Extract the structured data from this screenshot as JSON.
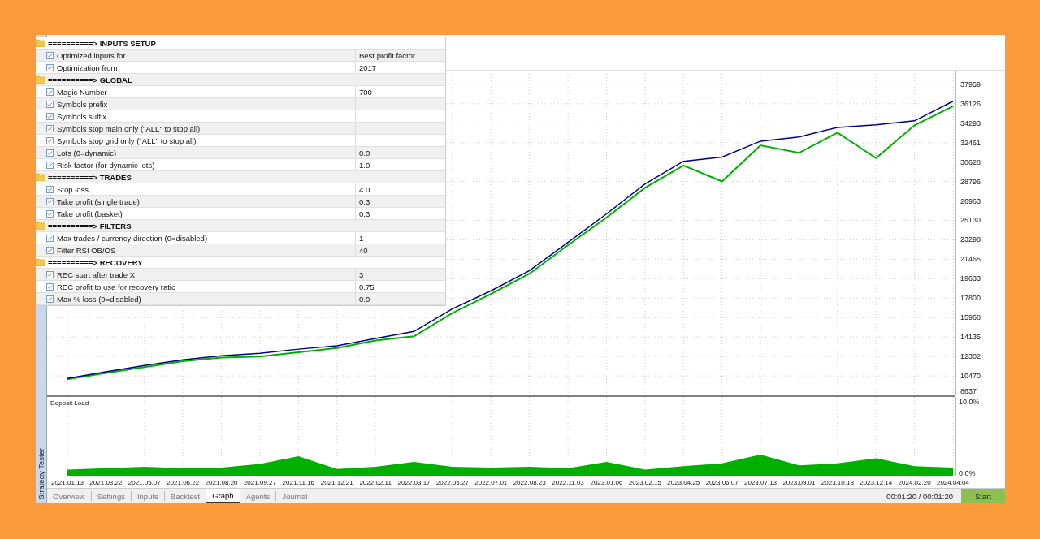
{
  "inputs": {
    "groups": [
      {
        "title": "==========> INPUTS SETUP",
        "items": [
          {
            "label": "Optimized inputs for",
            "value": "Best profit factor",
            "checked": true
          },
          {
            "label": "Optimization from",
            "value": "2017",
            "checked": true
          }
        ]
      },
      {
        "title": "==========> GLOBAL",
        "items": [
          {
            "label": "Magic Number",
            "value": "700",
            "checked": true
          },
          {
            "label": "Symbols prefix",
            "checked": true
          },
          {
            "label": "Symbols suffix",
            "checked": true
          },
          {
            "label": "Symbols stop main only (\"ALL\" to stop all)",
            "checked": true
          },
          {
            "label": "Symbols stop grid only (\"ALL\" to stop all)",
            "checked": true
          },
          {
            "label": "Lots (0=dynamic)",
            "value": "0.0",
            "checked": true
          },
          {
            "label": "Risk factor (for dynamic lots)",
            "value": "1.0",
            "checked": true
          }
        ]
      },
      {
        "title": "==========> TRADES",
        "items": [
          {
            "label": "Stop loss",
            "value": "4.0",
            "checked": true
          },
          {
            "label": "Take profit (single trade)",
            "value": "0.3",
            "checked": true
          },
          {
            "label": "Take profit (basket)",
            "value": "0.3",
            "checked": true
          }
        ]
      },
      {
        "title": "==========> FILTERS",
        "items": [
          {
            "label": "Max trades / currency direction (0=disabled)",
            "value": "1",
            "checked": true
          },
          {
            "label": "Filter RSI OB/OS",
            "value": "40",
            "checked": true
          }
        ]
      },
      {
        "title": "==========> RECOVERY",
        "items": [
          {
            "label": "REC start after trade X",
            "value": "3",
            "checked": true
          },
          {
            "label": "REC profit to use for recovery ratio",
            "value": "0.75",
            "checked": true
          },
          {
            "label": "Max % loss (0=disabled)",
            "value": "0.0",
            "checked": true
          }
        ]
      }
    ]
  },
  "balance_chart": {
    "chart_data": {
      "type": "line",
      "grid": true,
      "series": [
        {
          "color": "#00008b",
          "values": [
            10230,
            10850,
            11450,
            11990,
            12370,
            12600,
            12990,
            13300,
            14000,
            14660,
            16800,
            18490,
            20400,
            23060,
            25740,
            28570,
            30700,
            31100,
            32600,
            33000,
            33900,
            34140,
            34520,
            36360
          ]
        },
        {
          "color": "#00b000",
          "values": [
            10150,
            10750,
            11300,
            11850,
            12200,
            12300,
            12700,
            13100,
            13800,
            14200,
            16400,
            18200,
            20100,
            22800,
            25400,
            28200,
            30300,
            28800,
            32200,
            31500,
            33400,
            31000,
            34100,
            35900
          ]
        }
      ],
      "ylim": [
        8637,
        39250
      ],
      "yticks": [
        8637,
        10470,
        12302,
        14135,
        15968,
        17800,
        19633,
        21465,
        23298,
        25130,
        26963,
        28796,
        30628,
        32461,
        34293,
        36126,
        37959
      ]
    }
  },
  "deposit_chart": {
    "chart_data": {
      "type": "area",
      "title": "Deposit Load",
      "grid": true,
      "categories": [
        "2021.01.13",
        "2021.03.22",
        "2021.05.07",
        "2021.06.22",
        "2021.08.20",
        "2021.09.27",
        "2021.11.16",
        "2021.12.21",
        "2022.02.11",
        "2022.03.17",
        "2022.05.27",
        "2022.07.01",
        "2022.08.23",
        "2022.11.03",
        "2023.01.06",
        "2023.02.15",
        "2023.04.25",
        "2023.06.07",
        "2023.07.13",
        "2023.09.01",
        "2023.10.18",
        "2023.12.14",
        "2024.02.20",
        "2024.04.04"
      ],
      "series": [
        {
          "color": "#00b000",
          "values": [
            0.5,
            0.7,
            0.9,
            0.7,
            0.8,
            1.3,
            2.4,
            0.6,
            0.9,
            1.6,
            0.9,
            0.8,
            0.9,
            0.7,
            1.6,
            0.5,
            1.0,
            1.4,
            2.6,
            1.1,
            1.4,
            2.1,
            1.0,
            0.8
          ]
        }
      ],
      "ylim": [
        0,
        10
      ],
      "yticks": [
        {
          "value": 0,
          "label": "0.0%"
        },
        {
          "value": 10,
          "label": "10.0%"
        }
      ]
    }
  },
  "side_label": "Strategy Tester",
  "tabs": [
    {
      "label": "Overview",
      "selected": false
    },
    {
      "label": "Settings",
      "selected": false
    },
    {
      "label": "Inputs",
      "selected": false
    },
    {
      "label": "Backtest",
      "selected": false
    },
    {
      "label": "Graph",
      "selected": true
    },
    {
      "label": "Agents",
      "selected": false
    },
    {
      "label": "Journal",
      "selected": false
    }
  ],
  "timer": "00:01:20 / 00:01:20",
  "start_button": "Start"
}
